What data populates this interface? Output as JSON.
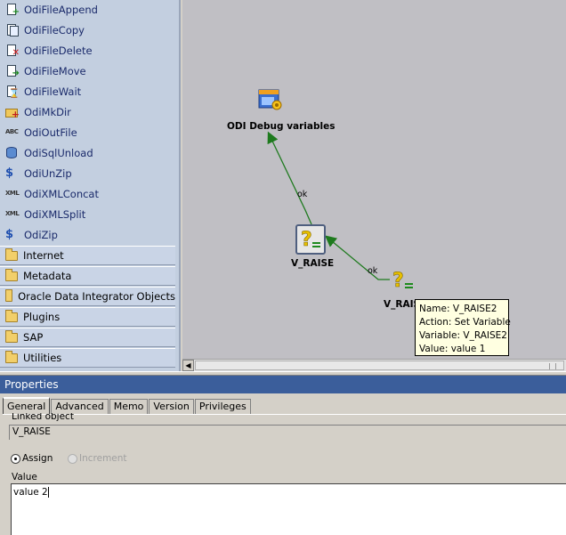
{
  "palette": {
    "tools": [
      {
        "label": "OdiFileAppend",
        "icon": "file-append-icon"
      },
      {
        "label": "OdiFileCopy",
        "icon": "file-copy-icon"
      },
      {
        "label": "OdiFileDelete",
        "icon": "file-delete-icon"
      },
      {
        "label": "OdiFileMove",
        "icon": "file-move-icon"
      },
      {
        "label": "OdiFileWait",
        "icon": "file-wait-icon"
      },
      {
        "label": "OdiMkDir",
        "icon": "mkdir-icon"
      },
      {
        "label": "OdiOutFile",
        "icon": "out-file-icon"
      },
      {
        "label": "OdiSqlUnload",
        "icon": "sql-unload-icon"
      },
      {
        "label": "OdiUnZip",
        "icon": "unzip-icon"
      },
      {
        "label": "OdiXMLConcat",
        "icon": "xml-concat-icon"
      },
      {
        "label": "OdiXMLSplit",
        "icon": "xml-split-icon"
      },
      {
        "label": "OdiZip",
        "icon": "zip-icon"
      }
    ],
    "folders": [
      {
        "label": "Internet"
      },
      {
        "label": "Metadata"
      },
      {
        "label": "Oracle Data Integrator Objects"
      },
      {
        "label": "Plugins"
      },
      {
        "label": "SAP"
      },
      {
        "label": "Utilities"
      }
    ]
  },
  "diagram": {
    "nodes": {
      "debug": {
        "label": "ODI Debug variables",
        "icon": "procedure-gear-icon"
      },
      "v_raise": {
        "label": "V_RAISE",
        "icon": "set-variable-icon"
      },
      "v_raise2": {
        "label": "V_RAIS",
        "icon": "set-variable-icon"
      }
    },
    "links": {
      "first": {
        "label": "ok"
      },
      "second": {
        "label": "ok"
      }
    },
    "link_color": "#1e7a1e"
  },
  "tooltip": {
    "name": "Name: V_RAISE2",
    "action": "Action: Set Variable",
    "variable": "Variable: V_RAISE2",
    "value": "Value: value 1"
  },
  "properties": {
    "title": "Properties",
    "tabs": [
      "General",
      "Advanced",
      "Memo",
      "Version",
      "Privileges"
    ],
    "active_tab": "General",
    "linked_object_label": "Linked object",
    "linked_object_value": "V_RAISE",
    "assign_label": "Assign",
    "increment_label": "Increment",
    "value_label": "Value",
    "value_text": "value 2",
    "header_color": "#3b5e9b"
  }
}
